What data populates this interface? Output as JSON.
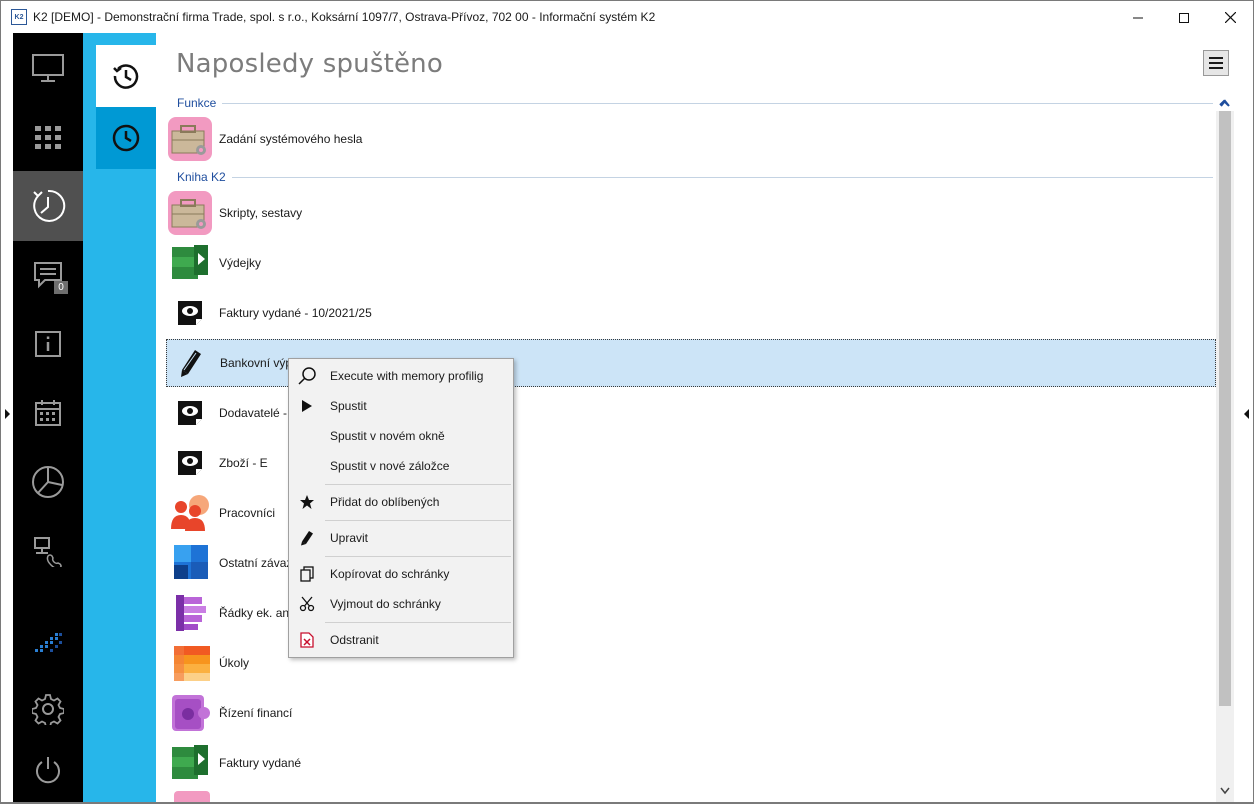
{
  "window": {
    "title": "K2 [DEMO] - Demonstrační firma Trade, spol. s r.o., Koksární 1097/7, Ostrava-Přívoz, 702 00 - Informační systém K2",
    "app_icon_text": "K2",
    "controls": [
      "minimize-icon",
      "maximize-icon",
      "close-icon"
    ]
  },
  "sidebar": {
    "items": [
      {
        "name": "monitor-icon"
      },
      {
        "name": "apps-grid-icon"
      },
      {
        "name": "recent-history-icon",
        "active": true
      },
      {
        "name": "messages-icon",
        "badge": "0"
      },
      {
        "name": "info-icon"
      },
      {
        "name": "calendar-icon"
      },
      {
        "name": "pie-chart-icon"
      },
      {
        "name": "network-phone-icon"
      },
      {
        "name": "k2-logo-icon"
      },
      {
        "name": "gear-icon"
      },
      {
        "name": "power-icon"
      }
    ]
  },
  "tabs": [
    {
      "name": "history-tab",
      "active": true
    },
    {
      "name": "clock-tab",
      "active": false
    }
  ],
  "main": {
    "title": "Naposledy spuštěno",
    "groups": [
      {
        "label": "Funkce",
        "items": [
          {
            "label": "Zadání systémového hesla",
            "icon": "toolbox-icon"
          }
        ]
      },
      {
        "label": "Kniha K2",
        "items": [
          {
            "label": "Skripty, sestavy",
            "icon": "toolbox-icon"
          },
          {
            "label": "Výdejky",
            "icon": "green-play-book-icon"
          },
          {
            "label": "Faktury vydané - 10/2021/25",
            "icon": "eye-document-icon"
          },
          {
            "label": "Bankovní výpi",
            "icon": "pencil-icon",
            "selected": true
          },
          {
            "label": "Dodavatelé -",
            "icon": "eye-document-icon"
          },
          {
            "label": "Zboží - E",
            "icon": "eye-document-icon"
          },
          {
            "label": "Pracovníci",
            "icon": "people-gear-icon"
          },
          {
            "label": "Ostatní závaz",
            "icon": "blue-grid-book-icon"
          },
          {
            "label": "Řádky ek. ana",
            "icon": "purple-list-icon"
          },
          {
            "label": "Úkoly",
            "icon": "orange-tasks-icon"
          },
          {
            "label": "Řízení financí",
            "icon": "purple-finance-icon"
          },
          {
            "label": "Faktury vydané",
            "icon": "green-play-book-icon"
          }
        ]
      }
    ]
  },
  "context_menu": {
    "items": [
      {
        "label": "Execute with memory profilig",
        "icon": "magnifier-icon"
      },
      {
        "label": "Spustit",
        "icon": "play-icon"
      },
      {
        "label": "Spustit v novém okně",
        "icon": ""
      },
      {
        "label": "Spustit v nové záložce",
        "icon": ""
      },
      {
        "label": "Přidat do oblíbených",
        "icon": "star-icon"
      },
      {
        "label": "Upravit",
        "icon": "pencil-icon"
      },
      {
        "label": "Kopírovat do schránky",
        "icon": "copy-icon"
      },
      {
        "label": "Vyjmout do schránky",
        "icon": "scissors-icon"
      },
      {
        "label": "Odstranit",
        "icon": "delete-icon"
      }
    ]
  },
  "colors": {
    "sidebar": "#000000",
    "sidebar_active": "#505050",
    "tabstrip": "#27b6ea",
    "selection": "#cce4f7",
    "group_text": "#1f4e9e"
  }
}
